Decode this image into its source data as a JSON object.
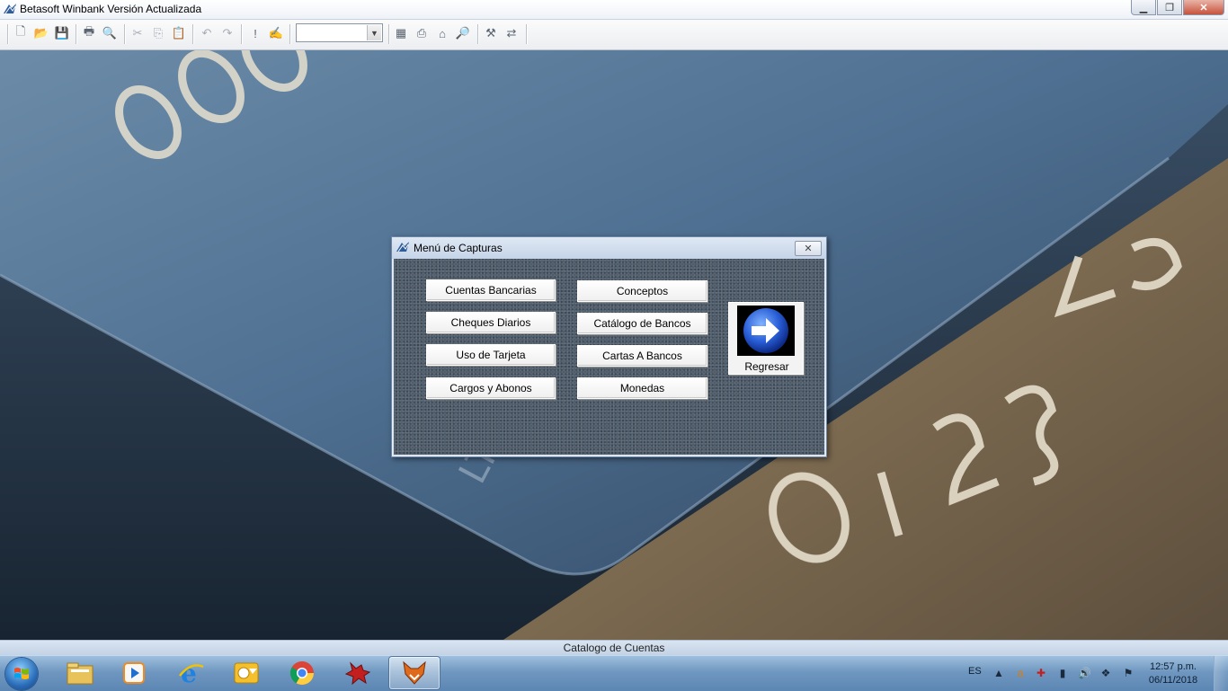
{
  "window": {
    "title": "Betasoft Winbank Versión Actualizada",
    "controls": [
      "minimize",
      "restore",
      "close"
    ]
  },
  "toolbar": {
    "combo_value": "",
    "icons": [
      "new-file-icon",
      "open-folder-icon",
      "save-icon",
      "print-icon",
      "print-preview-icon",
      "cut-icon",
      "copy-icon",
      "paste-icon",
      "undo-icon",
      "redo-icon",
      "exclamation-icon",
      "edit-check-icon",
      "calculator-icon",
      "printer-setup-icon",
      "page-setup-icon",
      "document-search-icon",
      "tools-icon",
      "export-icon"
    ]
  },
  "dialog": {
    "title": "Menú de Capturas",
    "close_label": "✕",
    "buttons_left": [
      "Cuentas Bancarias",
      "Cheques Diarios",
      "Uso de Tarjeta",
      "Cargos y Abonos"
    ],
    "buttons_right": [
      "Conceptos",
      "Catálogo de Bancos",
      "Cartas A Bancos",
      "Monedas"
    ],
    "return_label": "Regresar"
  },
  "statusbar": {
    "text": "Catalogo de Cuentas"
  },
  "taskbar": {
    "items": [
      "explorer-icon",
      "media-player-icon",
      "internet-explorer-icon",
      "outlook-icon",
      "chrome-icon",
      "app-red-icon",
      "fox-app-icon"
    ],
    "active_item": "fox-app-icon",
    "language": "ES",
    "time": "12:57 p.m.",
    "date": "06/11/2018"
  },
  "colors": {
    "dialog_body": "#4a5867",
    "taskbar": "#6f97c0",
    "close_button": "#c7523c"
  }
}
